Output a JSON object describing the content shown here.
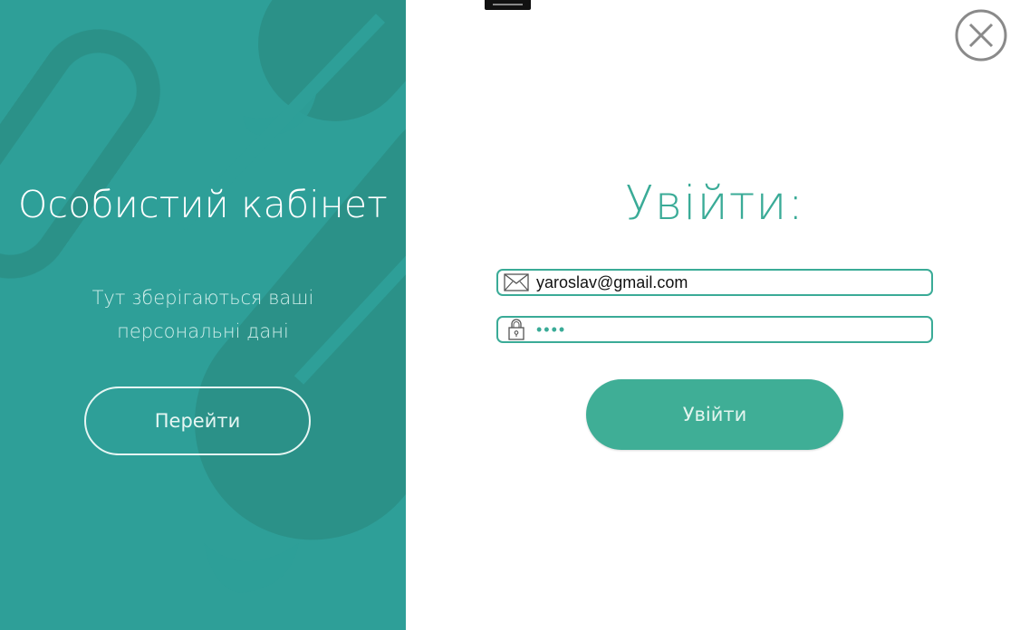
{
  "left_panel": {
    "title": "Особистий кабінет",
    "subtitle_line1": "Тут зберігаються ваші",
    "subtitle_line2": "персональні дані",
    "go_button_label": "Перейти",
    "background_color": "#2e9f98",
    "decor_icon": "pill-capsule-icon"
  },
  "login": {
    "title": "Увійти:",
    "email_value": "yaroslav@gmail.com",
    "email_icon": "envelope-icon",
    "password_value": "••••",
    "password_icon": "padlock-icon",
    "button_label": "Увійти",
    "accent_color": "#3aab97"
  },
  "window": {
    "close_icon": "close-circle-icon"
  }
}
